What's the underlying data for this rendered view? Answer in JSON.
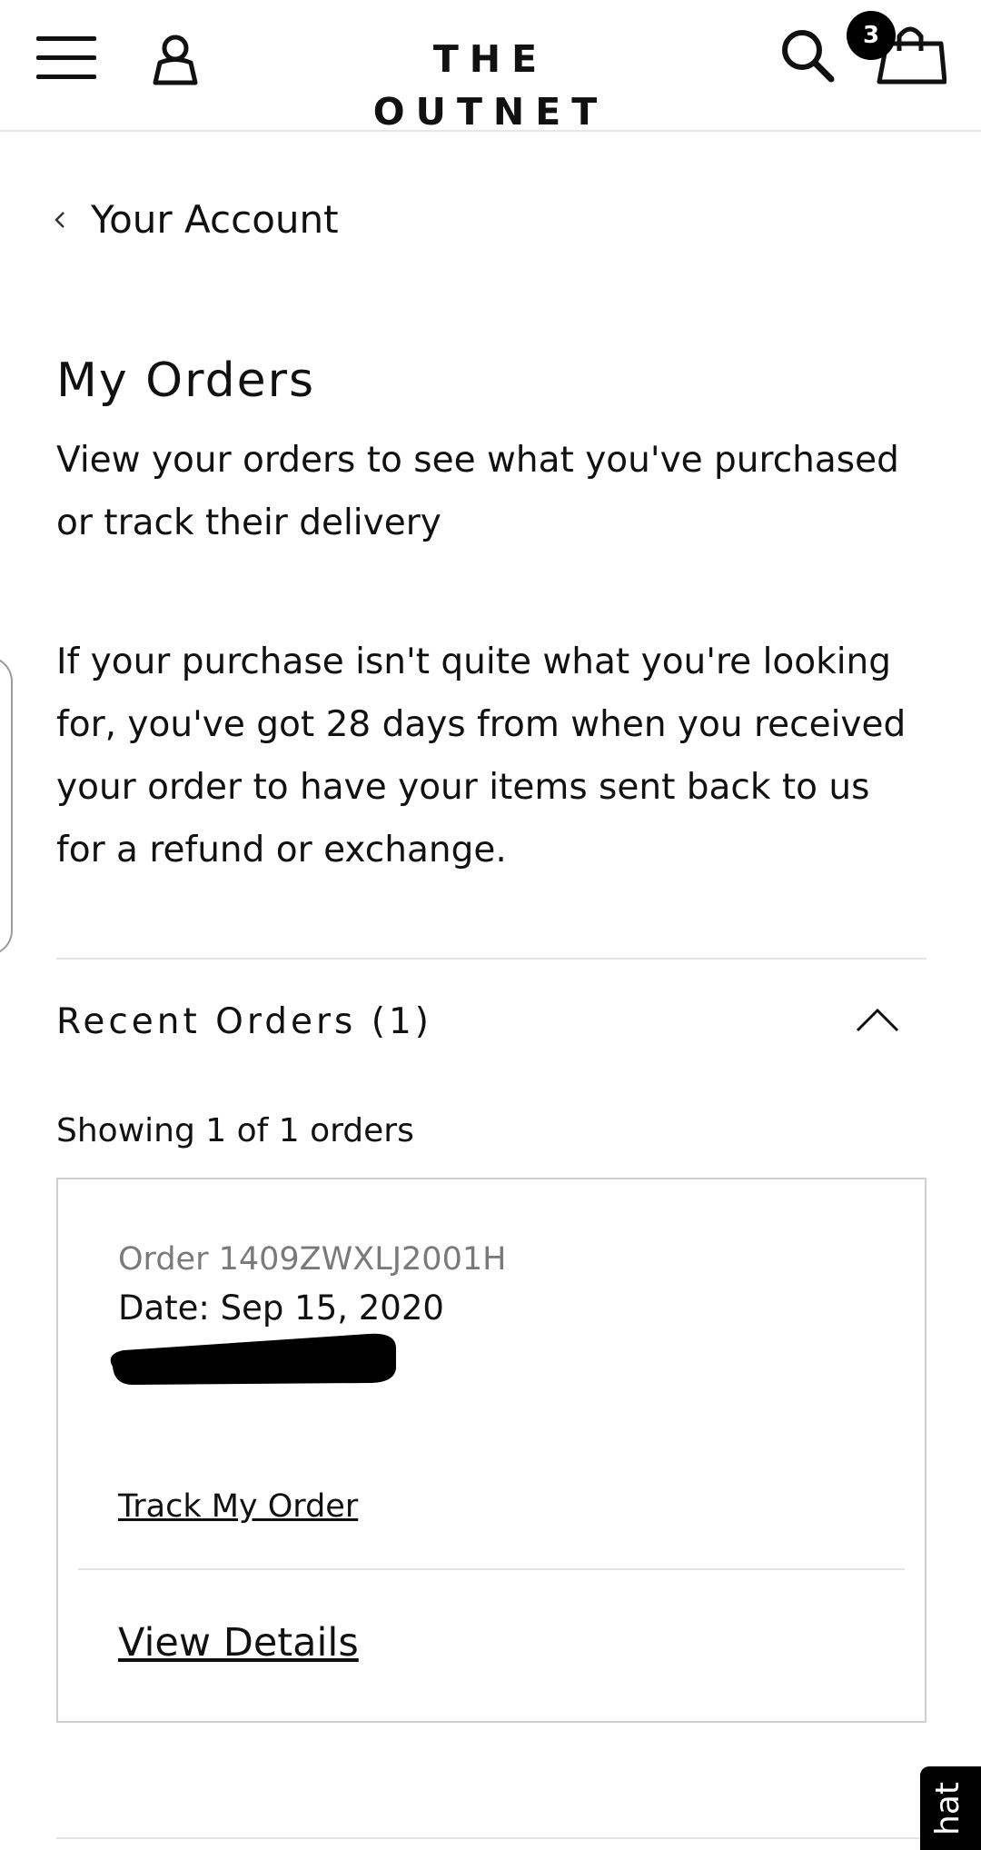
{
  "header": {
    "brand": "THE OUTNET",
    "bag_count": "3",
    "icons": [
      "menu-icon",
      "account-icon",
      "search-icon",
      "shopping-bag-icon"
    ]
  },
  "navigation": {
    "back_label": "Your Account"
  },
  "page": {
    "title": "My Orders",
    "intro": "View your orders to see what you've purchased or track their delivery",
    "returns_info": "If your purchase isn't quite what you're looking for, you've got 28 days from when you received your order to have your items sent back to us for a refund or exchange."
  },
  "recent_orders": {
    "title": "Recent Orders (1)",
    "showing": "Showing 1 of 1 orders",
    "orders": [
      {
        "number": "Order 1409ZWXLJ2001H",
        "date": "Date: Sep 15, 2020",
        "track_label": "Track My Order",
        "details_label": "View Details"
      }
    ]
  },
  "chat": {
    "label": "hat"
  },
  "colors": {
    "text": "#111111",
    "muted": "#7a7a7a",
    "divider": "#e3e3e3",
    "badge": "#000000"
  }
}
